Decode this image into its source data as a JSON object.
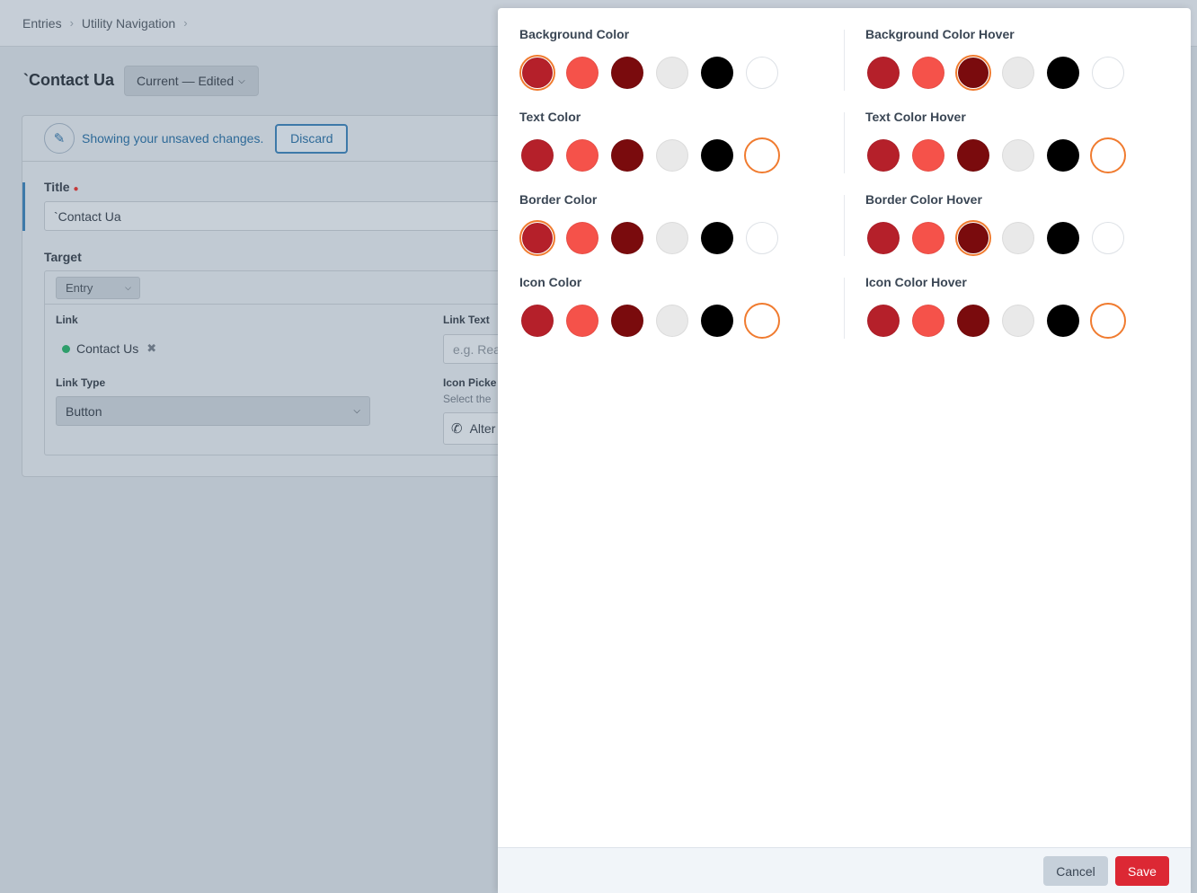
{
  "breadcrumb": {
    "items": [
      "Entries",
      "Utility Navigation"
    ],
    "separator": ">"
  },
  "page": {
    "title": "`Contact Ua",
    "status": "Current — Edited"
  },
  "notice": {
    "message": "Showing your unsaved changes.",
    "discard_label": "Discard"
  },
  "form": {
    "title_label": "Title",
    "title_value": "`Contact Ua",
    "target_label": "Target",
    "target_type": "Entry",
    "link_label": "Link",
    "link_value": "Contact Us",
    "link_text_label": "Link Text",
    "link_text_placeholder": "e.g. Rea",
    "link_type_label": "Link Type",
    "link_type_value": "Button",
    "icon_picker_label": "Icon Picke",
    "icon_picker_hint": "Select the",
    "icon_picker_value": "Alter"
  },
  "modal": {
    "swatch_colors": [
      "#b5202a",
      "#f5524a",
      "#7a0b0d",
      "#e9e9e9",
      "#000000",
      "#ffffff"
    ],
    "selection_ring_color": "#f07b2f",
    "fields": [
      {
        "label": "Background Color",
        "selected": 0
      },
      {
        "label": "Background Color Hover",
        "selected": 2
      },
      {
        "label": "Text Color",
        "selected": 5
      },
      {
        "label": "Text Color Hover",
        "selected": 5
      },
      {
        "label": "Border Color",
        "selected": 0
      },
      {
        "label": "Border Color Hover",
        "selected": 2
      },
      {
        "label": "Icon Color",
        "selected": 5
      },
      {
        "label": "Icon Color Hover",
        "selected": 5
      }
    ],
    "cancel_label": "Cancel",
    "save_label": "Save"
  }
}
